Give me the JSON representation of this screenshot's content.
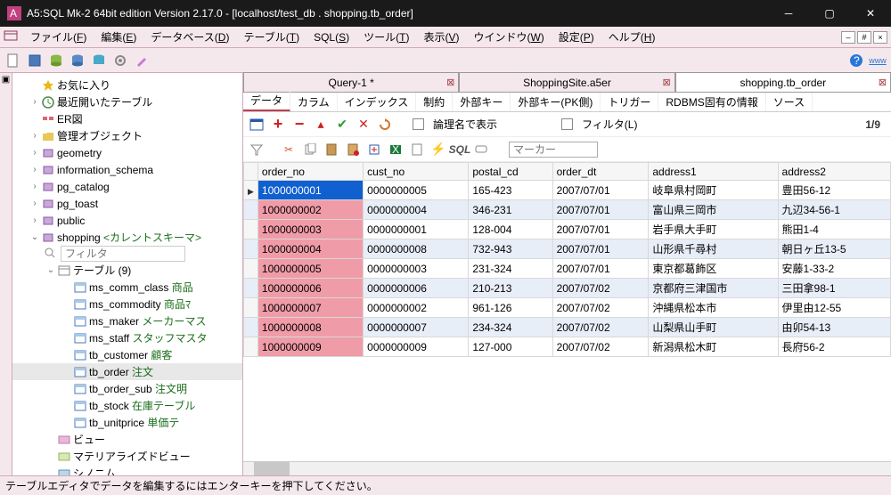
{
  "window": {
    "title": "A5:SQL Mk-2 64bit edition Version 2.17.0 - [localhost/test_db . shopping.tb_order]"
  },
  "menubar": {
    "items": [
      {
        "label": "ファイル",
        "key": "F"
      },
      {
        "label": "編集",
        "key": "E"
      },
      {
        "label": "データベース",
        "key": "D"
      },
      {
        "label": "テーブル",
        "key": "T"
      },
      {
        "label": "SQL",
        "key": "S"
      },
      {
        "label": "ツール",
        "key": "T"
      },
      {
        "label": "表示",
        "key": "V"
      },
      {
        "label": "ウインドウ",
        "key": "W"
      },
      {
        "label": "設定",
        "key": "P"
      },
      {
        "label": "ヘルプ",
        "key": "H"
      }
    ],
    "rbtns": [
      "–",
      "#",
      "×"
    ]
  },
  "tree": {
    "nodes": [
      {
        "depth": 1,
        "tw": "",
        "icon": "star",
        "label": "お気に入り",
        "note": ""
      },
      {
        "depth": 1,
        "tw": ">",
        "icon": "recent",
        "label": "最近開いたテーブル",
        "note": ""
      },
      {
        "depth": 1,
        "tw": "",
        "icon": "er",
        "label": "ER図",
        "note": ""
      },
      {
        "depth": 1,
        "tw": ">",
        "icon": "folder",
        "label": "管理オブジェクト",
        "note": ""
      },
      {
        "depth": 1,
        "tw": ">",
        "icon": "schema",
        "label": "geometry",
        "note": ""
      },
      {
        "depth": 1,
        "tw": ">",
        "icon": "schema",
        "label": "information_schema",
        "note": ""
      },
      {
        "depth": 1,
        "tw": ">",
        "icon": "schema",
        "label": "pg_catalog",
        "note": ""
      },
      {
        "depth": 1,
        "tw": ">",
        "icon": "schema",
        "label": "pg_toast",
        "note": ""
      },
      {
        "depth": 1,
        "tw": ">",
        "icon": "schema",
        "label": "public",
        "note": ""
      },
      {
        "depth": 1,
        "tw": "v",
        "icon": "schema",
        "label": "shopping",
        "note": " <カレントスキーマ>"
      },
      {
        "depth": 2,
        "tw": "",
        "icon": "filter",
        "label": "__FILTER__",
        "note": ""
      },
      {
        "depth": 2,
        "tw": "v",
        "icon": "tables",
        "label": "テーブル (9)",
        "note": ""
      },
      {
        "depth": 3,
        "tw": "",
        "icon": "table",
        "label": "ms_comm_class",
        "note": " 商品"
      },
      {
        "depth": 3,
        "tw": "",
        "icon": "table",
        "label": "ms_commodity",
        "note": " 商品ﾏ"
      },
      {
        "depth": 3,
        "tw": "",
        "icon": "table",
        "label": "ms_maker",
        "note": " メーカーマス"
      },
      {
        "depth": 3,
        "tw": "",
        "icon": "table",
        "label": "ms_staff",
        "note": " スタッフマスタ"
      },
      {
        "depth": 3,
        "tw": "",
        "icon": "table",
        "label": "tb_customer",
        "note": " 顧客"
      },
      {
        "depth": 3,
        "tw": "",
        "icon": "table",
        "label": "tb_order",
        "note": " 注文",
        "sel": true
      },
      {
        "depth": 3,
        "tw": "",
        "icon": "table",
        "label": "tb_order_sub",
        "note": " 注文明"
      },
      {
        "depth": 3,
        "tw": "",
        "icon": "table",
        "label": "tb_stock",
        "note": " 在庫テーブル"
      },
      {
        "depth": 3,
        "tw": "",
        "icon": "table",
        "label": "tb_unitprice",
        "note": " 単価テ"
      },
      {
        "depth": 2,
        "tw": "",
        "icon": "view",
        "label": "ビュー",
        "note": ""
      },
      {
        "depth": 2,
        "tw": "",
        "icon": "mview",
        "label": "マテリアライズドビュー",
        "note": ""
      },
      {
        "depth": 2,
        "tw": "",
        "icon": "syn",
        "label": "シノニム",
        "note": ""
      }
    ],
    "filter_placeholder": "フィルタ"
  },
  "tabs": [
    {
      "label": "Query-1 *",
      "active": false
    },
    {
      "label": "ShoppingSite.a5er",
      "active": false
    },
    {
      "label": "shopping.tb_order",
      "active": true
    }
  ],
  "subtabs": [
    "データ",
    "カラム",
    "インデックス",
    "制約",
    "外部キー",
    "外部キー(PK側)",
    "トリガー",
    "RDBMS固有の情報",
    "ソース"
  ],
  "subtab_active": 0,
  "toolbar2": {
    "show_logical": "論理名で表示",
    "filter_label": "フィルタ(L)",
    "counter": "1/9"
  },
  "toolbar3": {
    "marker_placeholder": "マーカー",
    "sql_label": "SQL"
  },
  "grid": {
    "columns": [
      "order_no",
      "cust_no",
      "postal_cd",
      "order_dt",
      "address1",
      "address2"
    ],
    "rows": [
      {
        "pk": "1000000001",
        "cells": [
          "0000000005",
          "165-423",
          "2007/07/01",
          "岐阜県村岡町",
          "豊田56-12"
        ],
        "current": true
      },
      {
        "pk": "1000000002",
        "cells": [
          "0000000004",
          "346-231",
          "2007/07/01",
          "富山県三岡市",
          "九辺34-56-1"
        ]
      },
      {
        "pk": "1000000003",
        "cells": [
          "0000000001",
          "128-004",
          "2007/07/01",
          "岩手県大手町",
          "熊田1-4"
        ]
      },
      {
        "pk": "1000000004",
        "cells": [
          "0000000008",
          "732-943",
          "2007/07/01",
          "山形県千尋村",
          "朝日ヶ丘13-5"
        ]
      },
      {
        "pk": "1000000005",
        "cells": [
          "0000000003",
          "231-324",
          "2007/07/01",
          "東京都葛飾区",
          "安藤1-33-2"
        ]
      },
      {
        "pk": "1000000006",
        "cells": [
          "0000000006",
          "210-213",
          "2007/07/02",
          "京都府三津国市",
          "三田拿98-1"
        ]
      },
      {
        "pk": "1000000007",
        "cells": [
          "0000000002",
          "961-126",
          "2007/07/02",
          "沖縄県松本市",
          "伊里由12-55"
        ]
      },
      {
        "pk": "1000000008",
        "cells": [
          "0000000007",
          "234-324",
          "2007/07/02",
          "山梨県山手町",
          "由卯54-13"
        ]
      },
      {
        "pk": "1000000009",
        "cells": [
          "0000000009",
          "127-000",
          "2007/07/02",
          "新潟県松木町",
          "長府56-2"
        ]
      }
    ]
  },
  "statusbar": {
    "text": "テーブルエディタでデータを編集するにはエンターキーを押下してください。"
  }
}
